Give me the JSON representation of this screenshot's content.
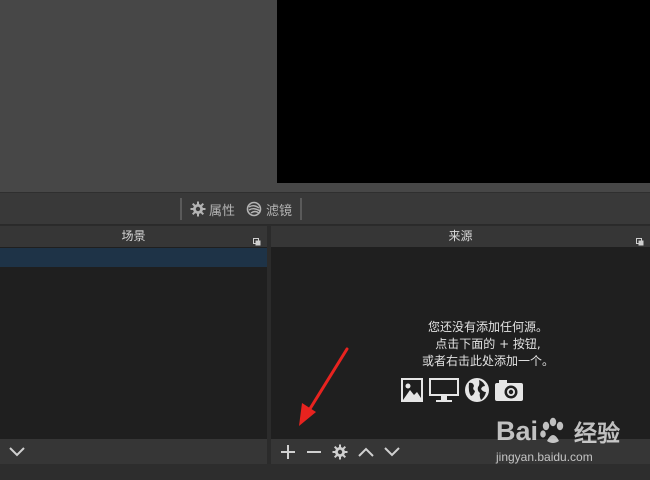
{
  "context_bar": {
    "properties_label": "属性",
    "filters_label": "滤镜"
  },
  "scenes_dock": {
    "title": "场景"
  },
  "sources_dock": {
    "title": "来源",
    "empty_line1": "您还没有添加任何源。",
    "empty_line2": "点击下面的 + 按钮,",
    "empty_line3": "或者右击此处添加一个。"
  },
  "icons": {
    "source_types": [
      "image-icon",
      "monitor-icon",
      "globe-icon",
      "camera-icon"
    ],
    "footer_buttons": [
      "add-icon",
      "remove-icon",
      "gear-icon",
      "chevron-up-icon",
      "chevron-down-icon"
    ]
  },
  "watermark": {
    "brand": "Bai",
    "brand_suffix": "经验",
    "url": "jingyan.baidu.com"
  },
  "colors": {
    "annotation_arrow": "#e8231f",
    "selection": "#1e3347"
  }
}
